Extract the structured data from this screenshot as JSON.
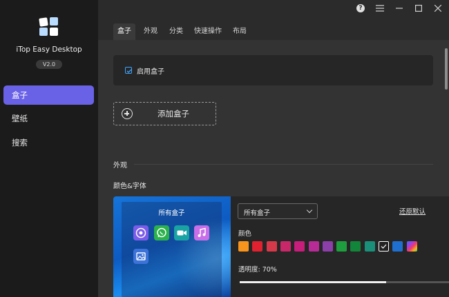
{
  "app": {
    "name": "iTop Easy Desktop",
    "version": "V2.0"
  },
  "sidebar": {
    "items": [
      {
        "label": "盒子",
        "active": true
      },
      {
        "label": "壁纸",
        "active": false
      },
      {
        "label": "搜索",
        "active": false
      }
    ]
  },
  "titlebar": {
    "buttons": [
      "help-icon",
      "menu-icon",
      "minimize-icon",
      "maximize-icon",
      "close-icon"
    ],
    "help_glyph": "?"
  },
  "tabs": [
    {
      "label": "盒子",
      "active": true
    },
    {
      "label": "外观",
      "active": false
    },
    {
      "label": "分类",
      "active": false
    },
    {
      "label": "快速操作",
      "active": false
    },
    {
      "label": "布局",
      "active": false
    }
  ],
  "content": {
    "enable_box": {
      "label": "启用盒子",
      "checked": true
    },
    "add_box_label": "添加盒子",
    "section_appearance": "外观",
    "sub_color_font": "颜色&字体",
    "preview": {
      "title": "所有盒子",
      "icons": [
        "chrome-icon",
        "whatsapp-icon",
        "video-call-icon",
        "music-icon",
        "image-icon"
      ]
    },
    "dropdown_value": "所有盒子",
    "reset_label": "还原默认",
    "color_label": "颜色",
    "swatches": [
      "#f7941d",
      "#e0212f",
      "#d63a4a",
      "#c8286a",
      "#c71d7b",
      "#b62b96",
      "#8c3fa8",
      "#1e9e3e",
      "#12853a",
      "#1a8f7a",
      "#222222",
      "#1f6fd1",
      "rainbow"
    ],
    "selected_swatch": 10,
    "opacity_label": "透明度:  70%",
    "opacity_value": 0.7
  },
  "colors": {
    "accent": "#6a62e6",
    "sidebar_bg": "#1b1b1b",
    "content_bg": "#333333",
    "checkbox": "#3ea6ff"
  }
}
